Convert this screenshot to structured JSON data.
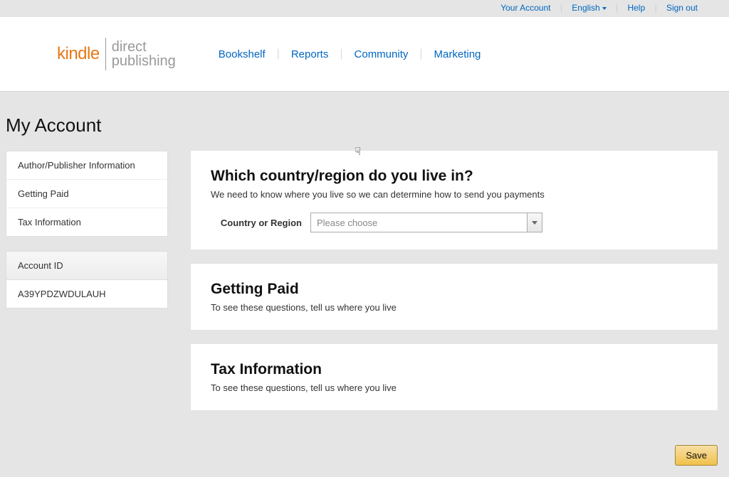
{
  "topbar": {
    "your_account": "Your Account",
    "language": "English",
    "help": "Help",
    "sign_out": "Sign out"
  },
  "logo": {
    "kindle": "kindle",
    "direct": "direct",
    "publishing": "publishing"
  },
  "nav": {
    "bookshelf": "Bookshelf",
    "reports": "Reports",
    "community": "Community",
    "marketing": "Marketing"
  },
  "page_title": "My Account",
  "sidebar": {
    "items": [
      "Author/Publisher Information",
      "Getting Paid",
      "Tax Information"
    ],
    "account_id_label": "Account ID",
    "account_id_value": "A39YPDZWDULAUH"
  },
  "panels": {
    "country": {
      "title": "Which country/region do you live in?",
      "desc": "We need to know where you live so we can determine how to send you payments",
      "label": "Country or Region",
      "placeholder": "Please choose"
    },
    "getting_paid": {
      "title": "Getting Paid",
      "desc": "To see these questions, tell us where you live"
    },
    "tax": {
      "title": "Tax Information",
      "desc": "To see these questions, tell us where you live"
    }
  },
  "save_button": "Save"
}
